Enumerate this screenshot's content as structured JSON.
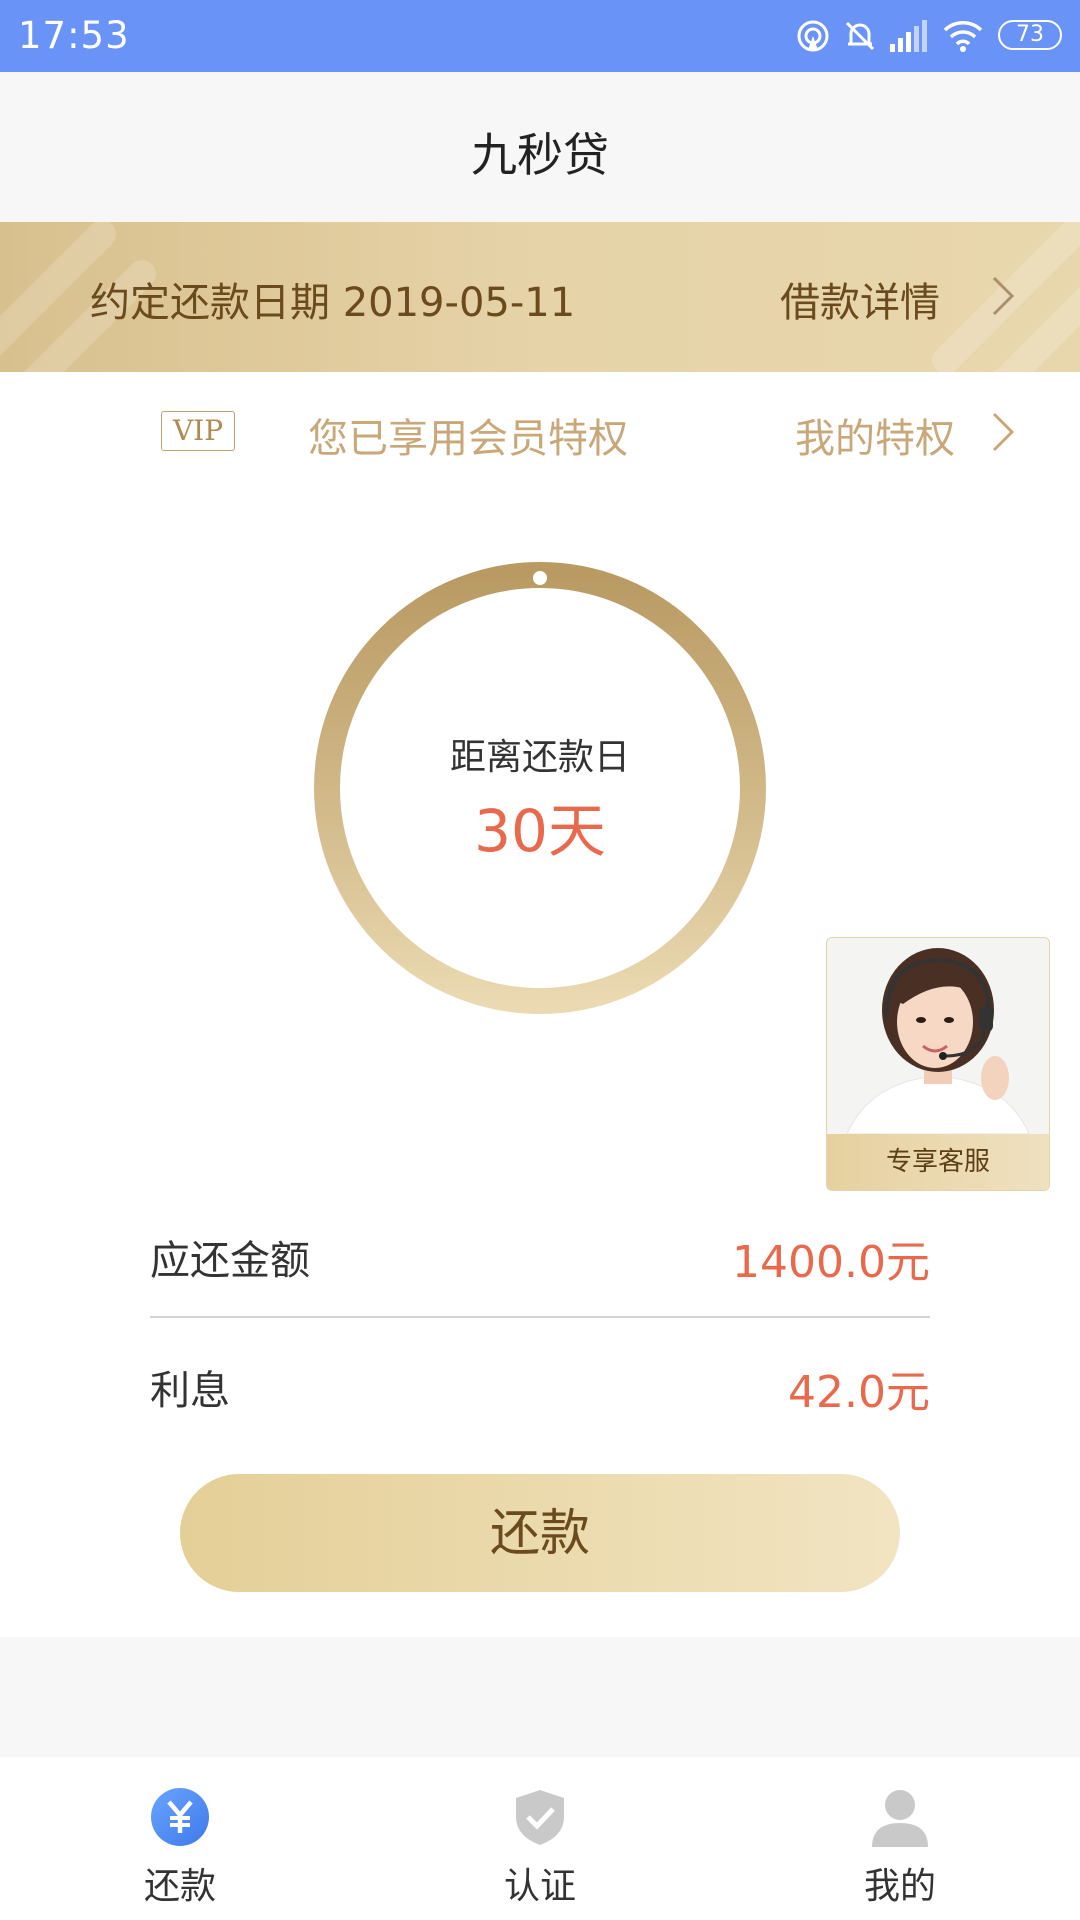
{
  "status_bar": {
    "time": "17:53",
    "battery": "73",
    "icons": [
      "hotspot-icon",
      "mute-bell-icon",
      "signal-icon",
      "wifi-icon",
      "battery-icon"
    ]
  },
  "header": {
    "title": "九秒贷"
  },
  "due_banner": {
    "due_date_text": "约定还款日期 2019-05-11",
    "detail_link": "借款详情"
  },
  "vip": {
    "badge": "VIP",
    "status_text": "您已享用会员特权",
    "privilege_link": "我的特权"
  },
  "countdown": {
    "label": "距离还款日",
    "value": "30天"
  },
  "customer_service": {
    "label": "专享客服"
  },
  "summary": {
    "amount_label": "应还金额",
    "amount_value": "1400.0元",
    "interest_label": "利息",
    "interest_value": "42.0元"
  },
  "repay_button": {
    "label": "还款"
  },
  "bottom_nav": {
    "items": [
      {
        "label": "还款",
        "icon": "yuan-icon",
        "active": true
      },
      {
        "label": "认证",
        "icon": "shield-check-icon",
        "active": false
      },
      {
        "label": "我的",
        "icon": "person-icon",
        "active": false
      }
    ]
  },
  "colors": {
    "status_bar": "#6a93f8",
    "gold": "#c9a778",
    "accent_red": "#e8694b",
    "banner_text": "#6b4a1d",
    "nav_active": "#4a86f0",
    "nav_inactive": "#c9c9c9"
  }
}
